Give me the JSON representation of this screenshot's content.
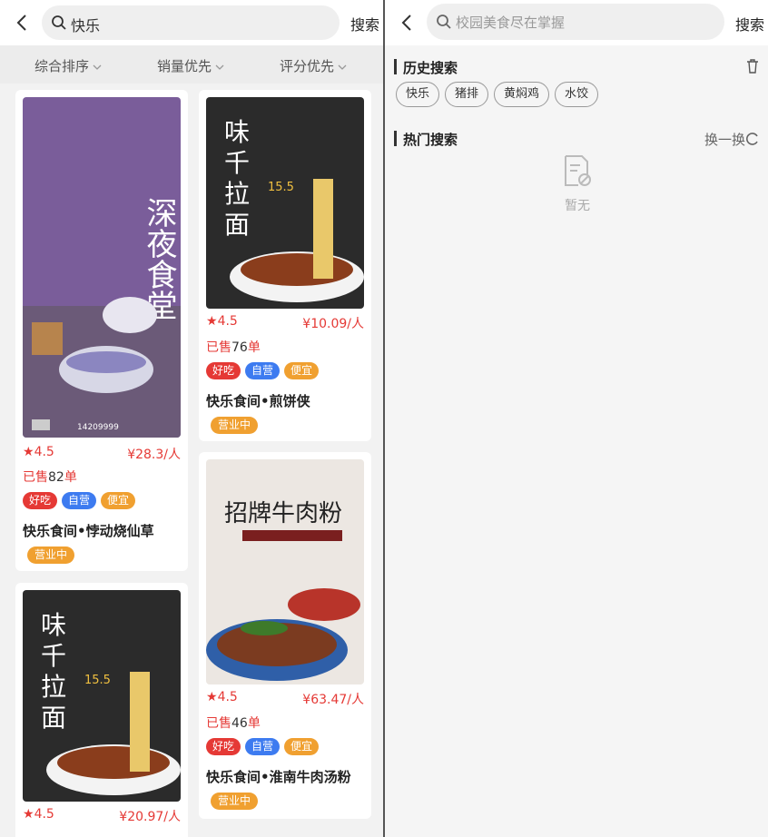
{
  "left": {
    "search": {
      "value": "快乐",
      "button": "搜索"
    },
    "sorts": [
      "综合排序",
      "销量优先",
      "评分优先"
    ],
    "products": [
      {
        "rating": "4.5",
        "price": "¥28.3/人",
        "sold_prefix": "已售",
        "sold_count": "82",
        "sold_unit": "单",
        "tags": [
          "好吃",
          "自营",
          "便宜"
        ],
        "title": "快乐食间•悖动烧仙草",
        "status": "营业中",
        "poster_icon": "late-night-dessert-poster",
        "poster_text": "深夜食堂"
      },
      {
        "rating": "4.5",
        "price": "¥10.09/人",
        "sold_prefix": "已售",
        "sold_count": "76",
        "sold_unit": "单",
        "tags": [
          "好吃",
          "自营",
          "便宜"
        ],
        "title": "快乐食间•煎饼侠",
        "status": "营业中",
        "poster_icon": "noodle-soup-poster",
        "poster_text": "味千拉面",
        "poster_price": "15.5"
      },
      {
        "rating": "4.5",
        "price": "¥63.47/人",
        "sold_prefix": "已售",
        "sold_count": "46",
        "sold_unit": "单",
        "tags": [
          "好吃",
          "自营",
          "便宜"
        ],
        "title": "快乐食间•淮南牛肉汤粉",
        "status": "营业中",
        "poster_icon": "beef-noodle-poster",
        "poster_text": "招牌牛肉粉"
      },
      {
        "rating": "4.5",
        "price": "¥20.97/人",
        "poster_icon": "noodle-soup-poster",
        "poster_text": "味千拉面",
        "poster_price": "15.5"
      }
    ]
  },
  "right": {
    "search": {
      "placeholder": "校园美食尽在掌握",
      "button": "搜索"
    },
    "history": {
      "title": "历史搜索",
      "chips": [
        "快乐",
        "猪排",
        "黄焖鸡",
        "水饺"
      ]
    },
    "hot": {
      "title": "热门搜索",
      "refresh": "换一换",
      "empty": "暂无"
    }
  },
  "colors": {
    "price_red": "#e53935",
    "tag_red": "#e53935",
    "tag_blue": "#3d7bf0",
    "tag_orange": "#f0a030"
  }
}
